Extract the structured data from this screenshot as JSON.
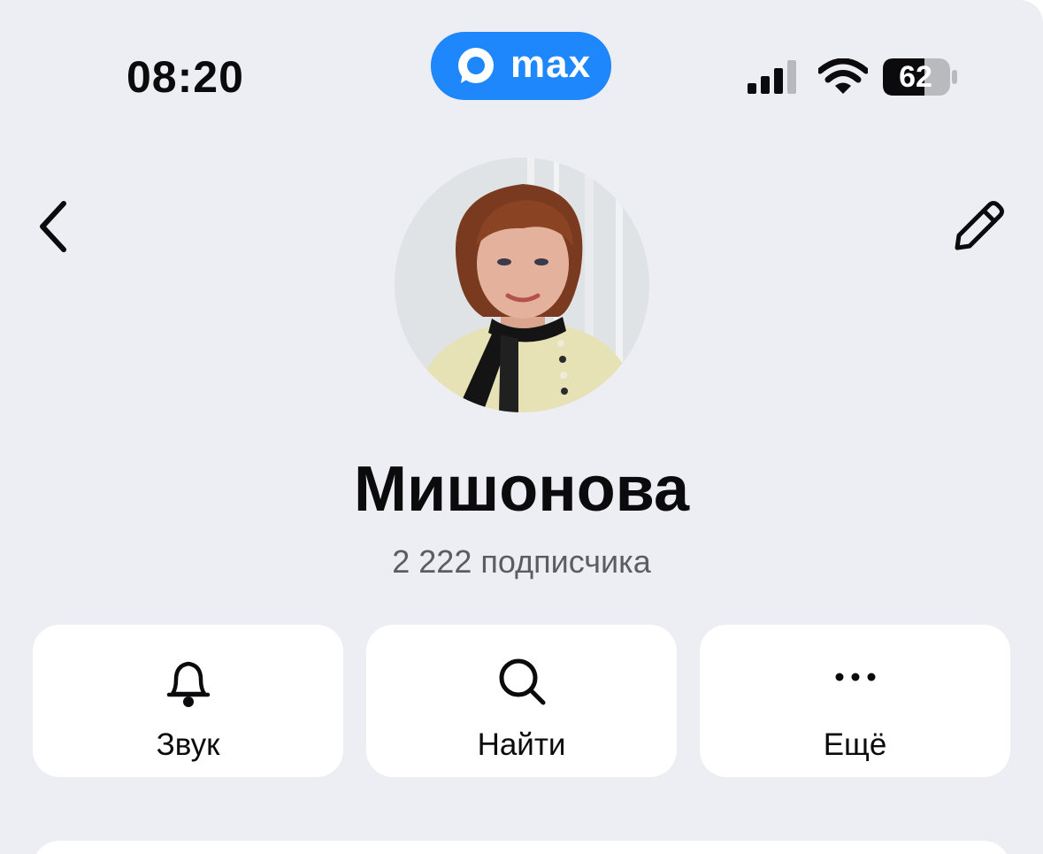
{
  "status_bar": {
    "time": "08:20",
    "brand": "max",
    "brand_color": "#1d87fb",
    "battery": "62"
  },
  "header": {
    "back_icon": "chevron-left-icon",
    "edit_icon": "pencil-icon"
  },
  "profile": {
    "name": "Мишонова",
    "subscribers": "2 222 подписчика"
  },
  "actions": [
    {
      "label": "Звук",
      "icon": "bell-icon"
    },
    {
      "label": "Найти",
      "icon": "search-icon"
    },
    {
      "label": "Ещё",
      "icon": "more-dots-icon"
    }
  ]
}
